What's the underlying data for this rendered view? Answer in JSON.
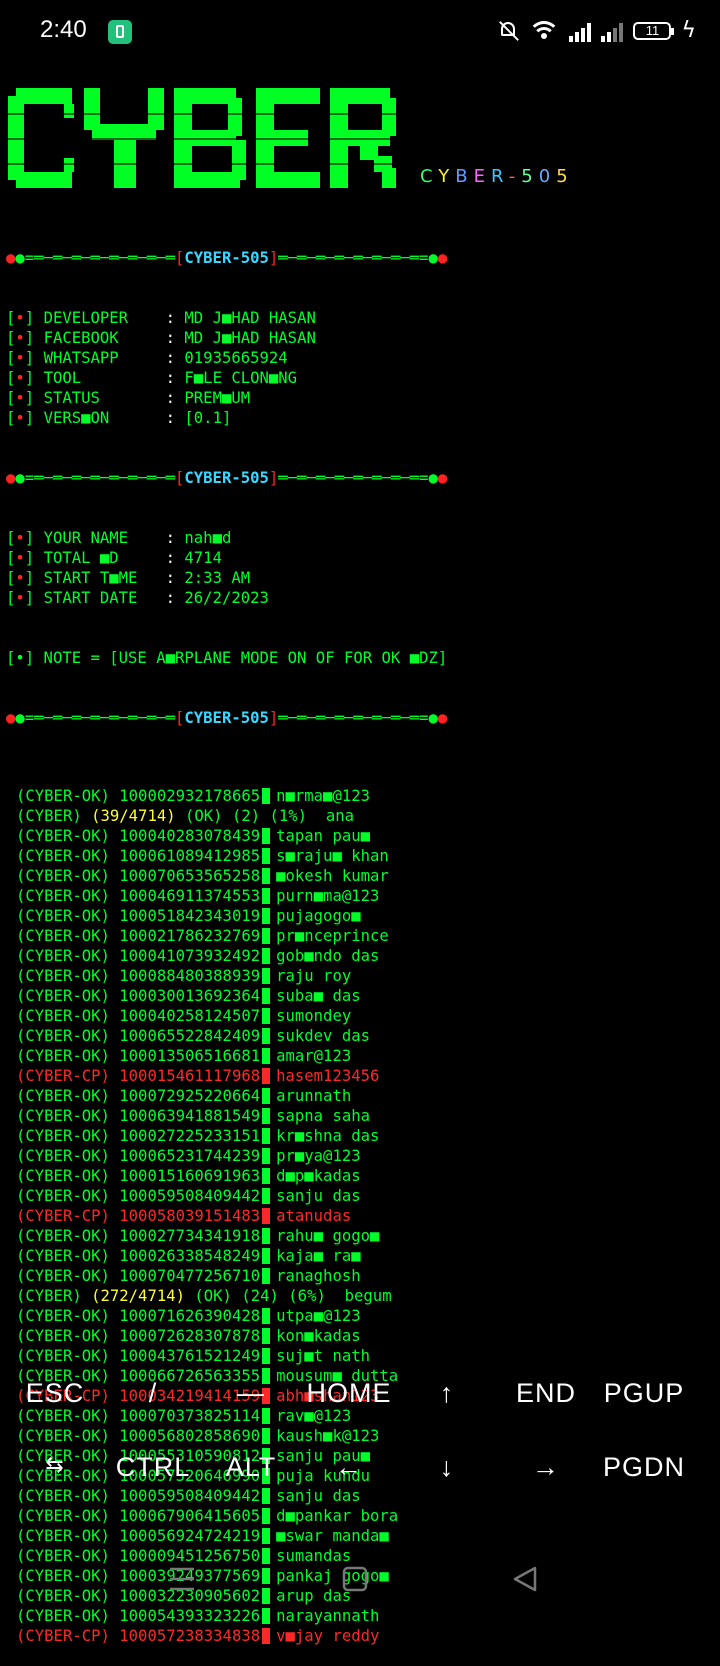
{
  "status_bar": {
    "time": "2:40",
    "battery_level": "11",
    "icons": [
      "battery-saver-icon",
      "mute-icon",
      "wifi-icon",
      "signal-icon",
      "signal-icon",
      "battery-icon",
      "charging-icon"
    ]
  },
  "banner": {
    "logo_text": "CYBER",
    "subtitle_letters": [
      "C",
      "Y",
      "B",
      "E",
      "R",
      "-",
      "5",
      "0",
      "5"
    ],
    "subtitle_colors": [
      "#33ff66",
      "#ffee33",
      "#6699ff",
      "#ff66ff",
      "#33ccff",
      "#ff5555",
      "#66ff99",
      "#66aaff",
      "#ffdd44"
    ]
  },
  "separator": {
    "left": "●=═─═─═─═─═─═─═─═",
    "tag": "CYBER-505",
    "right": "═─═─═─═─═─═─═─═=●"
  },
  "info": [
    {
      "bullet": "[•]",
      "label": "DEVELOPER    ",
      "value": "MD J■HAD HASAN"
    },
    {
      "bullet": "[•]",
      "label": "FACEBOOK     ",
      "value": "MD J■HAD HASAN"
    },
    {
      "bullet": "[•]",
      "label": "WHATSAPP     ",
      "value": "01935665924"
    },
    {
      "bullet": "[•]",
      "label": "TOOL         ",
      "value": "F■LE CLON■NG"
    },
    {
      "bullet": "[•]",
      "label": "STATUS       ",
      "value": "PREM■UM"
    },
    {
      "bullet": "[•]",
      "label": "VERS■ON      ",
      "value": "[0.1]"
    }
  ],
  "session": [
    {
      "bullet": "[•]",
      "label": "YOUR NAME    ",
      "value": "nah■d"
    },
    {
      "bullet": "[•]",
      "label": "TOTAL ■D     ",
      "value": "4714"
    },
    {
      "bullet": "[•]",
      "label": "START T■ME   ",
      "value": "2:33 AM"
    },
    {
      "bullet": "[•]",
      "label": "START DATE   ",
      "value": "26/2/2023"
    }
  ],
  "note": "[•] NOTE = [USE A■RPLANE MODE ON OF FOR OK ■DZ]",
  "results": [
    {
      "type": "ok",
      "tag": "(CYBER-OK)",
      "id": "100002932178665",
      "pass": "n■rma■@123"
    },
    {
      "type": "progress",
      "tag": "(CYBER)",
      "count": "(39/4714)",
      "ok": "(OK)",
      "oknum": "(2)",
      "pct": "(1%)",
      "name": "ana"
    },
    {
      "type": "ok",
      "tag": "(CYBER-OK)",
      "id": "100040283078439",
      "pass": "tapan pau■"
    },
    {
      "type": "ok",
      "tag": "(CYBER-OK)",
      "id": "100061089412985",
      "pass": "s■raju■ khan"
    },
    {
      "type": "ok",
      "tag": "(CYBER-OK)",
      "id": "100070653565258",
      "pass": "■okesh kumar"
    },
    {
      "type": "ok",
      "tag": "(CYBER-OK)",
      "id": "100046911374553",
      "pass": "purn■ma@123"
    },
    {
      "type": "ok",
      "tag": "(CYBER-OK)",
      "id": "100051842343019",
      "pass": "pujagogo■"
    },
    {
      "type": "ok",
      "tag": "(CYBER-OK)",
      "id": "100021786232769",
      "pass": "pr■nceprince"
    },
    {
      "type": "ok",
      "tag": "(CYBER-OK)",
      "id": "100041073932492",
      "pass": "gob■ndo das"
    },
    {
      "type": "ok",
      "tag": "(CYBER-OK)",
      "id": "100088480388939",
      "pass": "raju roy"
    },
    {
      "type": "ok",
      "tag": "(CYBER-OK)",
      "id": "100030013692364",
      "pass": "suba■ das"
    },
    {
      "type": "ok",
      "tag": "(CYBER-OK)",
      "id": "100040258124507",
      "pass": "sumondey"
    },
    {
      "type": "ok",
      "tag": "(CYBER-OK)",
      "id": "100065522842409",
      "pass": "sukdev das"
    },
    {
      "type": "ok",
      "tag": "(CYBER-OK)",
      "id": "100013506516681",
      "pass": "amar@123"
    },
    {
      "type": "cp",
      "tag": "(CYBER-CP)",
      "id": "100015461117968",
      "pass": "hasem123456"
    },
    {
      "type": "ok",
      "tag": "(CYBER-OK)",
      "id": "100072925220664",
      "pass": "arunnath"
    },
    {
      "type": "ok",
      "tag": "(CYBER-OK)",
      "id": "100063941881549",
      "pass": "sapna saha"
    },
    {
      "type": "ok",
      "tag": "(CYBER-OK)",
      "id": "100027225233151",
      "pass": "kr■shna das"
    },
    {
      "type": "ok",
      "tag": "(CYBER-OK)",
      "id": "100065231744239",
      "pass": "pr■ya@123"
    },
    {
      "type": "ok",
      "tag": "(CYBER-OK)",
      "id": "100015160691963",
      "pass": "d■p■kadas"
    },
    {
      "type": "ok",
      "tag": "(CYBER-OK)",
      "id": "100059508409442",
      "pass": "sanju das"
    },
    {
      "type": "cp",
      "tag": "(CYBER-CP)",
      "id": "100058039151483",
      "pass": "atanudas"
    },
    {
      "type": "ok",
      "tag": "(CYBER-OK)",
      "id": "100027734341918",
      "pass": "rahu■ gogo■"
    },
    {
      "type": "ok",
      "tag": "(CYBER-OK)",
      "id": "100026338548249",
      "pass": "kaja■ ra■"
    },
    {
      "type": "ok",
      "tag": "(CYBER-OK)",
      "id": "100070477256710",
      "pass": "ranaghosh"
    },
    {
      "type": "progress",
      "tag": "(CYBER)",
      "count": "(272/4714)",
      "ok": "(OK)",
      "oknum": "(24)",
      "pct": "(6%)",
      "name": "begum"
    },
    {
      "type": "ok",
      "tag": "(CYBER-OK)",
      "id": "100071626390428",
      "pass": "utpa■@123"
    },
    {
      "type": "ok",
      "tag": "(CYBER-OK)",
      "id": "100072628307878",
      "pass": "kon■kadas"
    },
    {
      "type": "ok",
      "tag": "(CYBER-OK)",
      "id": "100043761521249",
      "pass": "suj■t nath"
    },
    {
      "type": "ok",
      "tag": "(CYBER-OK)",
      "id": "100066726563355",
      "pass": "mousum■ dutta"
    },
    {
      "type": "cp",
      "tag": "(CYBER-CP)",
      "id": "100034219414159",
      "pass": "abh■shan123"
    },
    {
      "type": "ok",
      "tag": "(CYBER-OK)",
      "id": "100070373825114",
      "pass": "rav■@123"
    },
    {
      "type": "ok",
      "tag": "(CYBER-OK)",
      "id": "100056802858690",
      "pass": "kaush■k@123"
    },
    {
      "type": "ok",
      "tag": "(CYBER-OK)",
      "id": "100055310590812",
      "pass": "sanju pau■"
    },
    {
      "type": "ok",
      "tag": "(CYBER-OK)",
      "id": "100057320646990",
      "pass": "puja kundu"
    },
    {
      "type": "ok",
      "tag": "(CYBER-OK)",
      "id": "100059508409442",
      "pass": "sanju das"
    },
    {
      "type": "ok",
      "tag": "(CYBER-OK)",
      "id": "100067906415605",
      "pass": "d■pankar bora"
    },
    {
      "type": "ok",
      "tag": "(CYBER-OK)",
      "id": "100056924724219",
      "pass": "■swar manda■"
    },
    {
      "type": "ok",
      "tag": "(CYBER-OK)",
      "id": "100009451256750",
      "pass": "sumandas"
    },
    {
      "type": "ok",
      "tag": "(CYBER-OK)",
      "id": "100039249377569",
      "pass": "pankaj gogo■"
    },
    {
      "type": "ok",
      "tag": "(CYBER-OK)",
      "id": "100032230905602",
      "pass": "arup das"
    },
    {
      "type": "ok",
      "tag": "(CYBER-OK)",
      "id": "100054393323226",
      "pass": "narayannath"
    },
    {
      "type": "cp",
      "tag": "(CYBER-CP)",
      "id": "100057238334838",
      "pass": "v■jay reddy"
    }
  ],
  "extra_keys": {
    "row1": [
      "ESC",
      "/",
      "—",
      "HOME",
      "↑",
      "END",
      "PGUP"
    ],
    "row2": [
      "⇆",
      "CTRL",
      "ALT",
      "←",
      "↓",
      "→",
      "PGDN"
    ]
  },
  "nav": [
    "menu-icon",
    "home-icon",
    "back-icon"
  ]
}
